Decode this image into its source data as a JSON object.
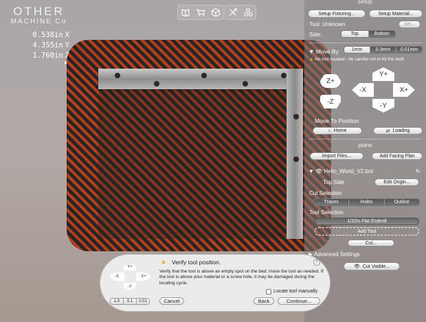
{
  "logo": {
    "line1": "OTHER",
    "line2": "MACHINE Co"
  },
  "coordinates": [
    {
      "value": "0.538in",
      "axis": "X"
    },
    {
      "value": "4.355in",
      "axis": "Y"
    },
    {
      "value": "1.760in",
      "axis": "Z"
    }
  ],
  "toolbar": {
    "icons": [
      "book-icon",
      "cart-icon",
      "cube-icon",
      "axes-icon",
      "settings-icon"
    ]
  },
  "setup": {
    "title": "setup",
    "setup_fixturing": "Setup Fixturing...",
    "setup_material": "Setup Material...",
    "tool_label": "Tool: Unknown",
    "set_button": "Set...",
    "side_label": "Side:",
    "side_options": [
      "Top",
      "Bottom"
    ],
    "side_selected": "Top"
  },
  "move_by": {
    "label": "Move By",
    "options": [
      "1mm",
      "0.3mm",
      "0.01mm"
    ],
    "selected": "1mm",
    "warning": "No tool located - be careful not to hit the bed!"
  },
  "jog": {
    "z_plus": "Z+",
    "z_minus": "-Z",
    "y_plus": "Y+",
    "y_minus": "-Y",
    "x_plus": "X+",
    "x_minus": "-X"
  },
  "move_to": {
    "label": "Move To Position",
    "home": "Home",
    "loading": "Loading"
  },
  "plans": {
    "title": "plans",
    "import_files": "Import Files...",
    "add_facing_plan": "Add Facing Plan",
    "file_name": "Hello_World_V2.brd",
    "side": "Top Side",
    "edit_origin": "Edit Origin...",
    "cut_selection_label": "Cut Selection",
    "cut_options": [
      "Traces",
      "Holes",
      "Outline"
    ],
    "tool_selection_label": "Tool Selection",
    "tool_name": "1/32in Flat Endmill",
    "add_tool": "Add Tool",
    "cut": "Cut...",
    "advanced_settings": "Advanced Settings",
    "cut_visible": "Cut Visible..."
  },
  "dialog": {
    "title": "Verify tool position.",
    "text": "Verify that the tool is above an empty spot on the bed; move the tool as needed. If the tool is above your material or a screw hole, it may be damaged during the locating cycle.",
    "help": "?",
    "jog": {
      "y_plus": "Y+",
      "y_minus": "-Y",
      "x_plus": "X+",
      "x_minus": "-X"
    },
    "step_options": [
      "1.0",
      "0.1",
      "0.01"
    ],
    "step_selected": "1.0",
    "cancel": "Cancel",
    "locate_manually": "Locate tool manually",
    "back": "Back",
    "continue": "Continue..."
  },
  "colors": {
    "bed_stripe_dark": "#2a2523",
    "bed_stripe_red": "#b3401e",
    "warning": "#f2b01e",
    "button_bg": "#f0f0f0"
  }
}
